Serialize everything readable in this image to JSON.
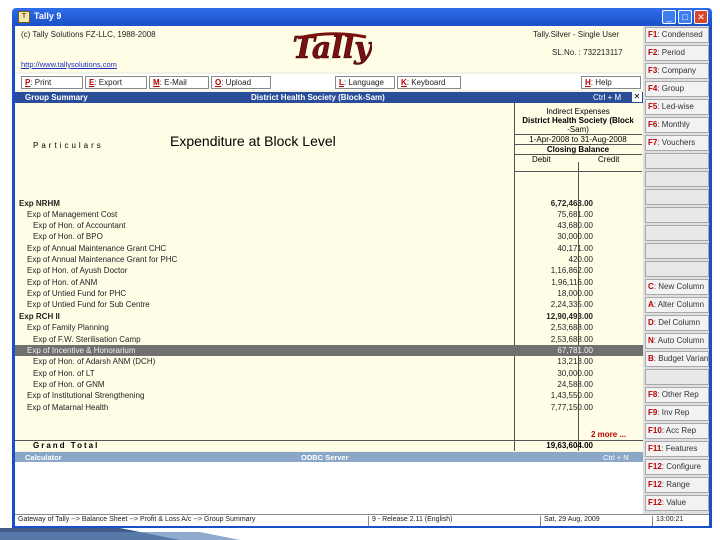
{
  "window": {
    "title": "Tally 9",
    "icon_label": "T",
    "min": "_",
    "max": "□",
    "close": "✕"
  },
  "header": {
    "copyright": "(c) Tally Solutions FZ-LLC, 1988-2008",
    "url": "http://www.tallysolutions.com",
    "edition": "Tally.Silver - Single User",
    "serial": "SL.No. : 732213117",
    "logo_text": "Tally"
  },
  "topbar": [
    {
      "key": "P",
      "label": ": Print"
    },
    {
      "key": "E",
      "label": ": Export"
    },
    {
      "key": "M",
      "label": ": E-Mail"
    },
    {
      "key": "O",
      "label": ": Upload"
    },
    {
      "key": "L",
      "label": ": Language"
    },
    {
      "key": "K",
      "label": ": Keyboard"
    },
    {
      "key": "H",
      "label": ": Help"
    }
  ],
  "report": {
    "name": "Group Summary",
    "company": "District Health Society (Block-Sam)",
    "shortcut": "Ctrl + M",
    "close": "✕",
    "particulars": "Particulars",
    "col_header": {
      "line1": "Indirect Expenses",
      "line2": "District Health Society (Block",
      "line3": "-Sam)",
      "period": "1-Apr-2008 to 31-Aug-2008",
      "closing": "Closing Balance",
      "debit": "Debit",
      "credit": "Credit"
    },
    "overlay_title": "Expenditure at Block Level",
    "rows": [
      {
        "label": "Exp NRHM",
        "amount": "6,72,463.00",
        "indent": 0,
        "bold": true
      },
      {
        "label": "Exp of Management Cost",
        "amount": "75,681.00",
        "indent": 1
      },
      {
        "label": "Exp of Hon. of Accountant",
        "amount": "43,680.00",
        "indent": 2
      },
      {
        "label": "Exp of Hon. of BPO",
        "amount": "30,000.00",
        "indent": 2
      },
      {
        "label": "Exp of Annual Maintenance Grant CHC",
        "amount": "40,171.00",
        "indent": 1
      },
      {
        "label": "Exp of Annual Maintenance Grant for PHC",
        "amount": "420.00",
        "indent": 1
      },
      {
        "label": "Exp of Hon. of Ayush Doctor",
        "amount": "1,16,862.00",
        "indent": 1
      },
      {
        "label": "Exp of Hon. of ANM",
        "amount": "1,96,116.00",
        "indent": 1
      },
      {
        "label": "Exp of Untied Fund for PHC",
        "amount": "18,000.00",
        "indent": 1
      },
      {
        "label": "Exp of Untied Fund for Sub Centre",
        "amount": "2,24,335.00",
        "indent": 1
      },
      {
        "label": "Exp RCH II",
        "amount": "12,90,493.00",
        "indent": 0,
        "bold": true
      },
      {
        "label": "Exp of Family Planning",
        "amount": "2,53,688.00",
        "indent": 1
      },
      {
        "label": "Exp of F.W. Sterilisation Camp",
        "amount": "2,53,688.00",
        "indent": 2
      },
      {
        "label": "Exp of Incentive & Honorarium",
        "amount": "67,781.00",
        "indent": 1,
        "selected": true
      },
      {
        "label": "Exp of Hon. of Adarsh ANM (DCH)",
        "amount": "13,213.00",
        "indent": 2
      },
      {
        "label": "Exp of Hon. of LT",
        "amount": "30,000.00",
        "indent": 2
      },
      {
        "label": "Exp of Hon. of GNM",
        "amount": "24,588.00",
        "indent": 2
      },
      {
        "label": "Exp of Institutional Strengthening",
        "amount": "1,43,550.00",
        "indent": 1
      },
      {
        "label": "Exp of Matarnal Health",
        "amount": "7,77,150.00",
        "indent": 1
      }
    ],
    "more": "2 more ...",
    "grand_total_label": "Grand Total",
    "grand_total": "19,63,604.00"
  },
  "calc": {
    "label": "Calculator",
    "odbc": "ODBC Server",
    "shortcut": "Ctrl + N"
  },
  "status": {
    "path": "Gateway of Tally --> Balance Sheet --> Profit & Loss A/c --> Group Summary",
    "release": "9 - Release 2.11 (English)",
    "date": "Sat, 29 Aug, 2009",
    "time": "13:00:21"
  },
  "right_buttons": [
    {
      "key": "F1",
      "label": ": Condensed"
    },
    {
      "key": "F2",
      "label": ": Period"
    },
    {
      "key": "F3",
      "label": ": Company"
    },
    {
      "key": "F4",
      "label": ": Group"
    },
    {
      "key": "F5",
      "label": ": Led-wise"
    },
    {
      "key": "F6",
      "label": ": Monthly"
    },
    {
      "key": "F7",
      "label": ": Vouchers"
    },
    {
      "key": "",
      "label": ""
    },
    {
      "key": "",
      "label": ""
    },
    {
      "key": "",
      "label": ""
    },
    {
      "key": "",
      "label": ""
    },
    {
      "key": "",
      "label": ""
    },
    {
      "key": "",
      "label": ""
    },
    {
      "key": "",
      "label": ""
    },
    {
      "key": "C",
      "label": ": New Column"
    },
    {
      "key": "A",
      "label": ": Alter Column"
    },
    {
      "key": "D",
      "label": ": Del Column"
    },
    {
      "key": "N",
      "label": ": Auto Column"
    },
    {
      "key": "B",
      "label": ": Budget Variance"
    },
    {
      "key": "",
      "label": ""
    },
    {
      "key": "F8",
      "label": ": Other Rep"
    },
    {
      "key": "F9",
      "label": ": Inv Rep"
    },
    {
      "key": "F10",
      "label": ": Acc Rep"
    },
    {
      "key": "F11",
      "label": ": Features"
    },
    {
      "key": "F12",
      "label": ": Configure"
    },
    {
      "key": "F12",
      "label": ": Range"
    },
    {
      "key": "F12",
      "label": ": Value"
    }
  ],
  "colors": {
    "title": "#1a4fc9",
    "band": "#2a4d9a",
    "report_bg": "#fffde6",
    "hotkey": "#b00000"
  }
}
